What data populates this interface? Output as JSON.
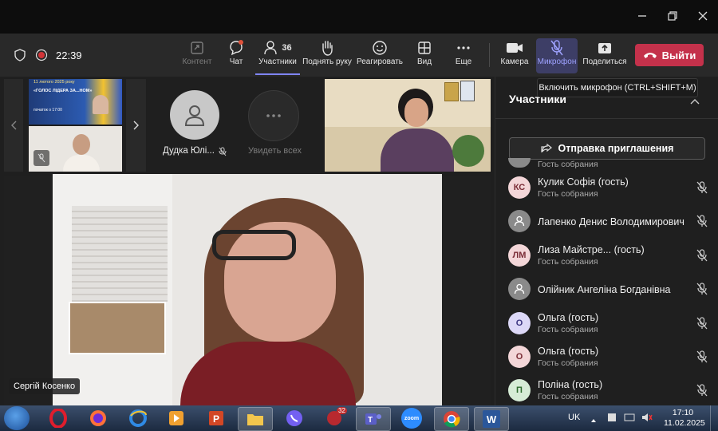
{
  "toolbar": {
    "timer": "22:39",
    "buttons": {
      "content": "Контент",
      "chat": "Чат",
      "participants": "Участники",
      "participants_count": "36",
      "raise_hand": "Поднять руку",
      "react": "Реагировать",
      "view": "Вид",
      "more": "Еще",
      "camera": "Камера",
      "microphone": "Микрофон",
      "share": "Поделиться",
      "leave": "Выйти"
    },
    "tooltip": "Включить микрофон (CTRL+SHIFT+M)"
  },
  "gallery": {
    "slide_text_1": "11 лютого 2025 року",
    "slide_text_2": "«ГОЛОС ЛІДЕРА ЗА...НОМ»",
    "slide_text_3": "початок о 17:00",
    "tile_name": "Дудка Юлі...",
    "see_all": "Увидеть всех"
  },
  "main_video": {
    "speaker_label": "Сергій Косенко"
  },
  "panel": {
    "title": "Участники",
    "invite_button": "Отправка приглашения",
    "partial_role": "Гость собрания",
    "participants": [
      {
        "initials": "КС",
        "name": "Кулик Софія (гость)",
        "role": "Гость собрания",
        "color": "#f3d6d8",
        "fg": "#7a2c36"
      },
      {
        "initials": "",
        "name": "Лапенко Денис Володимирович",
        "role": "",
        "color": "#8a8a8a",
        "fg": "#fff"
      },
      {
        "initials": "ЛМ",
        "name": "Лиза Майстре...  (гость)",
        "role": "Гость собрания",
        "color": "#f3d6d8",
        "fg": "#7a2c36"
      },
      {
        "initials": "",
        "name": "Олійник Ангеліна Богданівна",
        "role": "",
        "color": "#8a8a8a",
        "fg": "#fff"
      },
      {
        "initials": "О",
        "name": "Ольга (гость)",
        "role": "Гость собрания",
        "color": "#dcd8f7",
        "fg": "#3b3580"
      },
      {
        "initials": "О",
        "name": "Ольга (гость)",
        "role": "Гость собрания",
        "color": "#f3d6d8",
        "fg": "#7a2c36"
      },
      {
        "initials": "П",
        "name": "Поліна (гость)",
        "role": "Гость собрания",
        "color": "#d6ecd6",
        "fg": "#2e6b2e"
      }
    ]
  },
  "taskbar": {
    "lang": "UK",
    "time": "17:10",
    "date": "11.02.2025",
    "badge": "32",
    "zoom_label": "zoom",
    "word_label": "W"
  },
  "colors": {
    "accent": "#7f85f5",
    "leave": "#c4314b",
    "record": "#d13438"
  }
}
